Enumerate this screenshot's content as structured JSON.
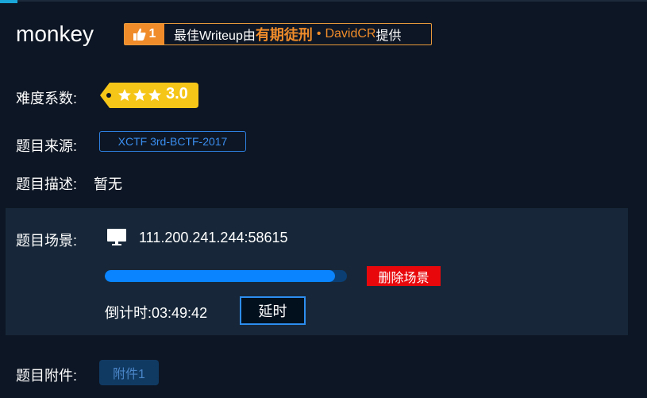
{
  "challenge": {
    "title": "monkey"
  },
  "writeup_badge": {
    "likes": "1",
    "text_prefix": "最佳Writeup由",
    "team": "有期徒刑",
    "separator": "•",
    "author": "DavidCR",
    "text_suffix": "提供",
    "accent_color": "#f08c2a"
  },
  "difficulty": {
    "label": "难度系数:",
    "stars": 3,
    "value": "3.0",
    "tag_color": "#f5c518"
  },
  "source": {
    "label": "题目来源:",
    "value": "XCTF 3rd-BCTF-2017"
  },
  "description": {
    "label": "题目描述:",
    "value": "暂无"
  },
  "scene": {
    "label": "题目场景:",
    "icon": "monitor-icon",
    "address": "111.200.241.244:58615",
    "progress": 0.95,
    "delete_label": "删除场景",
    "countdown_label": "倒计时:",
    "countdown_value": "03:49:42",
    "extend_label": "延时"
  },
  "attachment": {
    "label": "题目附件:",
    "button_label": "附件1"
  }
}
